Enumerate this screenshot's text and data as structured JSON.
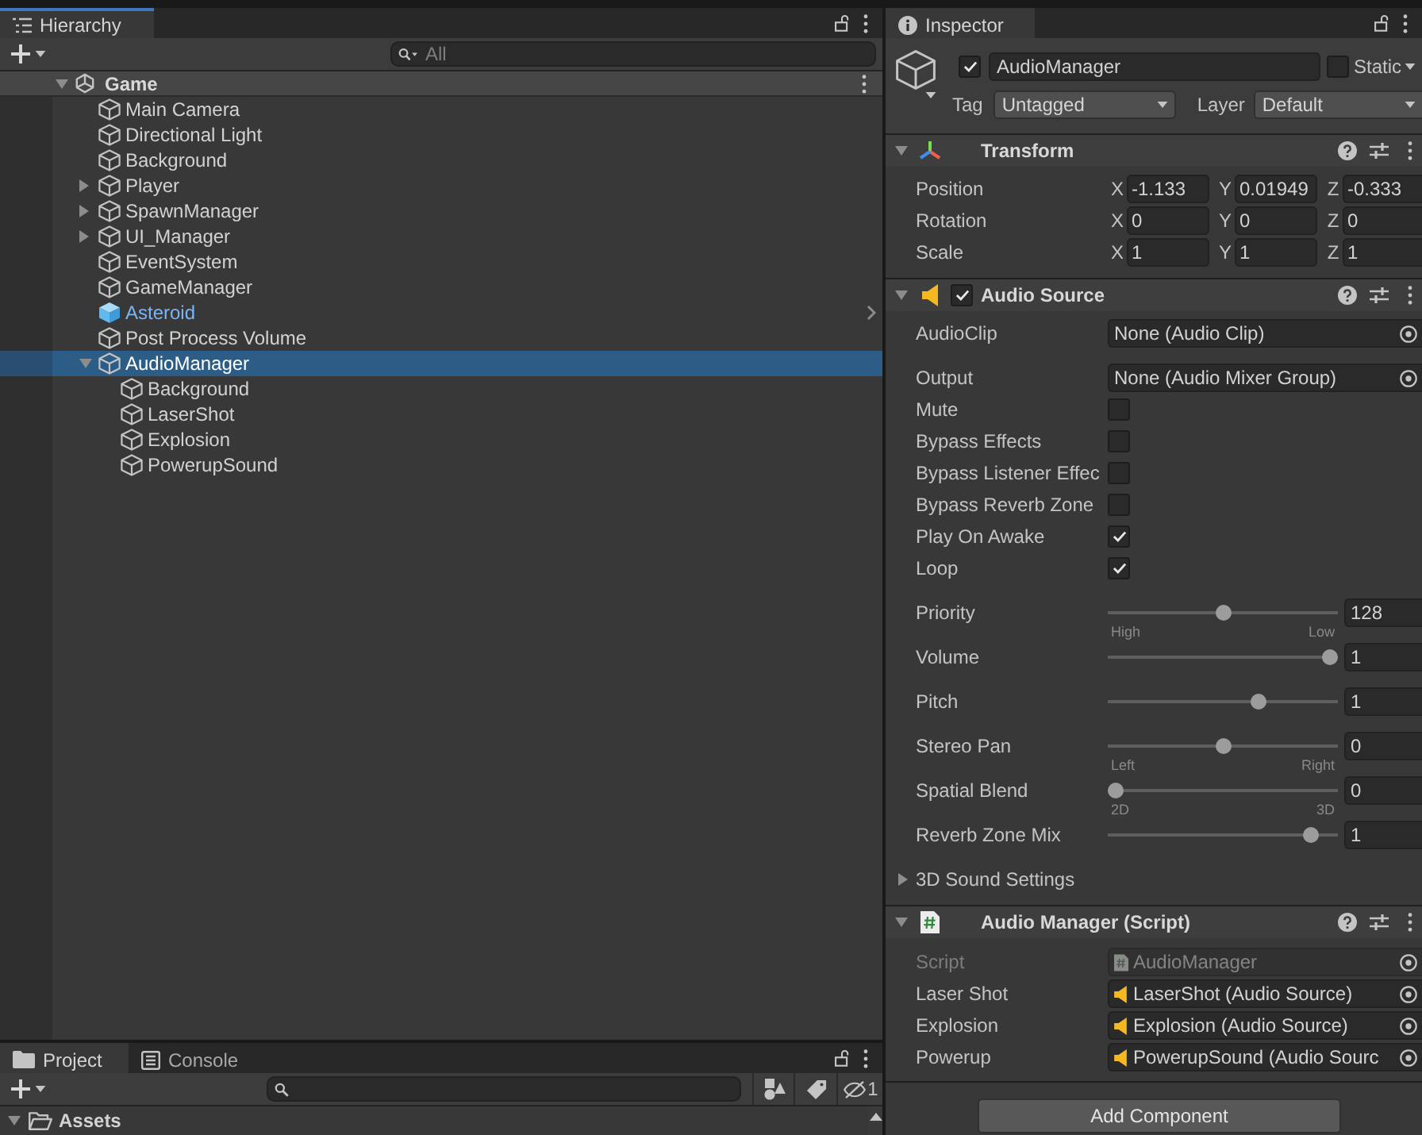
{
  "hierarchy": {
    "tab": {
      "label": "Hierarchy",
      "selected": true,
      "focused": true
    },
    "search": {
      "placeholder": "All"
    },
    "scene": {
      "name": "Game",
      "expanded": true,
      "children": [
        {
          "name": "Main Camera",
          "kind": "object",
          "expandable": false,
          "expanded": false,
          "selected": false
        },
        {
          "name": "Directional Light",
          "kind": "object",
          "expandable": false,
          "expanded": false,
          "selected": false
        },
        {
          "name": "Background",
          "kind": "object",
          "expandable": false,
          "expanded": false,
          "selected": false
        },
        {
          "name": "Player",
          "kind": "object",
          "expandable": true,
          "expanded": false,
          "selected": false
        },
        {
          "name": "SpawnManager",
          "kind": "object",
          "expandable": true,
          "expanded": false,
          "selected": false
        },
        {
          "name": "UI_Manager",
          "kind": "object",
          "expandable": true,
          "expanded": false,
          "selected": false
        },
        {
          "name": "EventSystem",
          "kind": "object",
          "expandable": false,
          "expanded": false,
          "selected": false
        },
        {
          "name": "GameManager",
          "kind": "object",
          "expandable": false,
          "expanded": false,
          "selected": false
        },
        {
          "name": "Asteroid",
          "kind": "prefab",
          "expandable": false,
          "expanded": false,
          "selected": false
        },
        {
          "name": "Post Process Volume",
          "kind": "object",
          "expandable": false,
          "expanded": false,
          "selected": false
        },
        {
          "name": "AudioManager",
          "kind": "object",
          "expandable": true,
          "expanded": true,
          "selected": true,
          "children": [
            {
              "name": "Background",
              "kind": "object",
              "expandable": false,
              "expanded": false,
              "selected": false
            },
            {
              "name": "LaserShot",
              "kind": "object",
              "expandable": false,
              "expanded": false,
              "selected": false
            },
            {
              "name": "Explosion",
              "kind": "object",
              "expandable": false,
              "expanded": false,
              "selected": false
            },
            {
              "name": "PowerupSound",
              "kind": "object",
              "expandable": false,
              "expanded": false,
              "selected": false
            }
          ]
        }
      ]
    }
  },
  "project": {
    "tabs": [
      {
        "label": "Project",
        "selected": true,
        "focused": false
      },
      {
        "label": "Console",
        "selected": false,
        "focused": false
      }
    ],
    "hidden_count": "1",
    "tree": [
      {
        "name": "Assets",
        "expanded": true
      }
    ]
  },
  "inspector": {
    "tab": {
      "label": "Inspector",
      "selected": true,
      "focused": false
    },
    "object": {
      "active": true,
      "name": "AudioManager",
      "static": false,
      "static_label": "Static",
      "tag_label": "Tag",
      "tag": "Untagged",
      "layer_label": "Layer",
      "layer": "Default"
    },
    "components": [
      {
        "kind": "transform",
        "title": "Transform",
        "expanded": true,
        "rows": [
          {
            "label": "Position",
            "axes": [
              {
                "axis": "X",
                "value": "-1.133"
              },
              {
                "axis": "Y",
                "value": "0.01949"
              },
              {
                "axis": "Z",
                "value": "-0.333"
              }
            ]
          },
          {
            "label": "Rotation",
            "axes": [
              {
                "axis": "X",
                "value": "0"
              },
              {
                "axis": "Y",
                "value": "0"
              },
              {
                "axis": "Z",
                "value": "0"
              }
            ]
          },
          {
            "label": "Scale",
            "axes": [
              {
                "axis": "X",
                "value": "1"
              },
              {
                "axis": "Y",
                "value": "1"
              },
              {
                "axis": "Z",
                "value": "1"
              }
            ]
          }
        ]
      },
      {
        "kind": "audio_source",
        "title": "Audio Source",
        "enabled": true,
        "expanded": true,
        "properties": [
          {
            "kind": "object",
            "label": "AudioClip",
            "value": "None (Audio Clip)",
            "disabled": false
          },
          {
            "kind": "object",
            "label": "Output",
            "value": "None (Audio Mixer Group)",
            "disabled": false
          },
          {
            "kind": "checkbox",
            "label": "Mute",
            "checked": false
          },
          {
            "kind": "checkbox",
            "label": "Bypass Effects",
            "checked": false
          },
          {
            "kind": "checkbox",
            "label": "Bypass Listener Effec",
            "checked": false
          },
          {
            "kind": "checkbox",
            "label": "Bypass Reverb Zone",
            "checked": false
          },
          {
            "kind": "checkbox",
            "label": "Play On Awake",
            "checked": true
          },
          {
            "kind": "checkbox",
            "label": "Loop",
            "checked": true
          },
          {
            "kind": "slider",
            "label": "Priority",
            "level": 0.5,
            "value": "128",
            "min_label": "High",
            "max_label": "Low"
          },
          {
            "kind": "slider",
            "label": "Volume",
            "level": 1,
            "value": "1"
          },
          {
            "kind": "slider",
            "label": "Pitch",
            "level": 0.667,
            "value": "1"
          },
          {
            "kind": "slider",
            "label": "Stereo Pan",
            "level": 0.5,
            "value": "0",
            "min_label": "Left",
            "max_label": "Right"
          },
          {
            "kind": "slider",
            "label": "Spatial Blend",
            "level": 0,
            "value": "0",
            "min_label": "2D",
            "max_label": "3D"
          },
          {
            "kind": "slider",
            "label": "Reverb Zone Mix",
            "level": 0.91,
            "value": "1"
          }
        ],
        "foldouts": [
          {
            "label": "3D Sound Settings",
            "expanded": false
          }
        ]
      },
      {
        "kind": "script",
        "title": "Audio Manager (Script)",
        "expanded": true,
        "properties": [
          {
            "kind": "script_ref",
            "label": "Script",
            "value": "AudioManager",
            "disabled": true
          },
          {
            "kind": "audio_ref",
            "label": "Laser Shot",
            "value": "LaserShot (Audio Source)",
            "disabled": false
          },
          {
            "kind": "audio_ref",
            "label": "Explosion",
            "value": "Explosion (Audio Source)",
            "disabled": false
          },
          {
            "kind": "audio_ref",
            "label": "Powerup",
            "value": "PowerupSound (Audio Sourc",
            "disabled": false
          }
        ]
      }
    ],
    "add_component": "Add Component"
  }
}
